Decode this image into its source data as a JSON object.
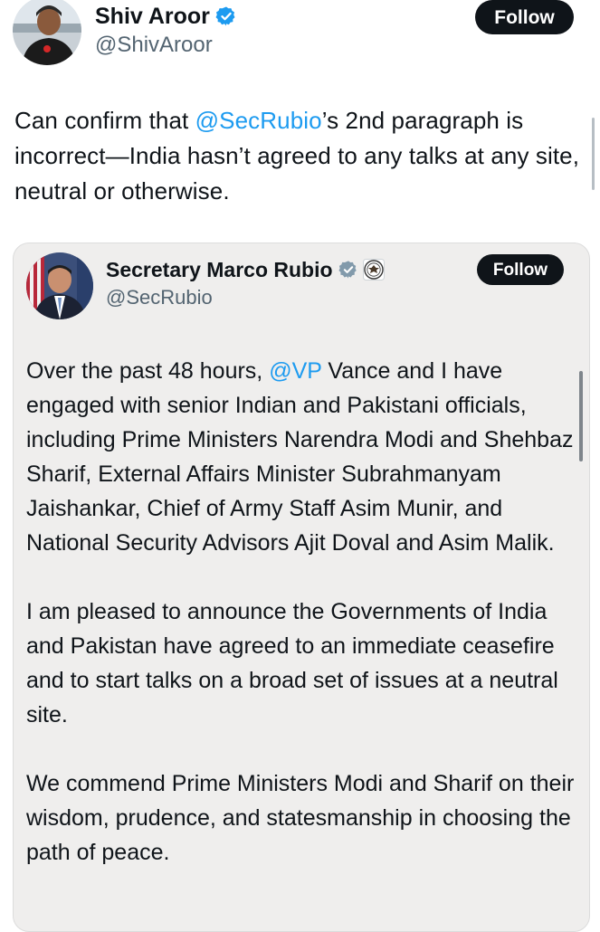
{
  "tweet": {
    "author": {
      "name": "Shiv Aroor",
      "handle": "@ShivAroor",
      "verified": true,
      "avatar_icon": "profile-photo-icon"
    },
    "follow_label": "Follow",
    "text": {
      "before_mention": "Can confirm that ",
      "mention": "@SecRubio",
      "after_mention": "’s 2nd paragraph is incorrect—India hasn’t agreed to any talks at any site, neutral or otherwise."
    }
  },
  "quoted_tweet": {
    "author": {
      "name": "Secretary Marco Rubio",
      "handle": "@SecRubio",
      "badge": "government-verified",
      "seal_icon": "us-state-department-seal-icon",
      "avatar_icon": "profile-photo-icon"
    },
    "follow_label": "Follow",
    "paragraphs": {
      "p1_before": "Over the past 48 hours, ",
      "p1_mention": "@VP",
      "p1_after": " Vance and I have engaged with senior Indian and Pakistani officials, including Prime Ministers Narendra Modi and Shehbaz Sharif, External Affairs Minister Subrahmanyam Jaishankar, Chief of Army Staff Asim Munir, and National Security Advisors Ajit Doval and Asim Malik.",
      "p2": "I am pleased to announce the Governments of India and Pakistan have agreed to an immediate ceasefire and to start talks on a broad set of issues at a neutral site.",
      "p3": "We commend Prime Ministers Modi and Sharif on their wisdom, prudence, and statesmanship in choosing the path of peace."
    }
  },
  "colors": {
    "accent": "#1d9bf0",
    "text": "#0f1419",
    "secondary_text": "#536471",
    "follow_bg": "#0f1419",
    "quote_bg": "#efeeed"
  }
}
